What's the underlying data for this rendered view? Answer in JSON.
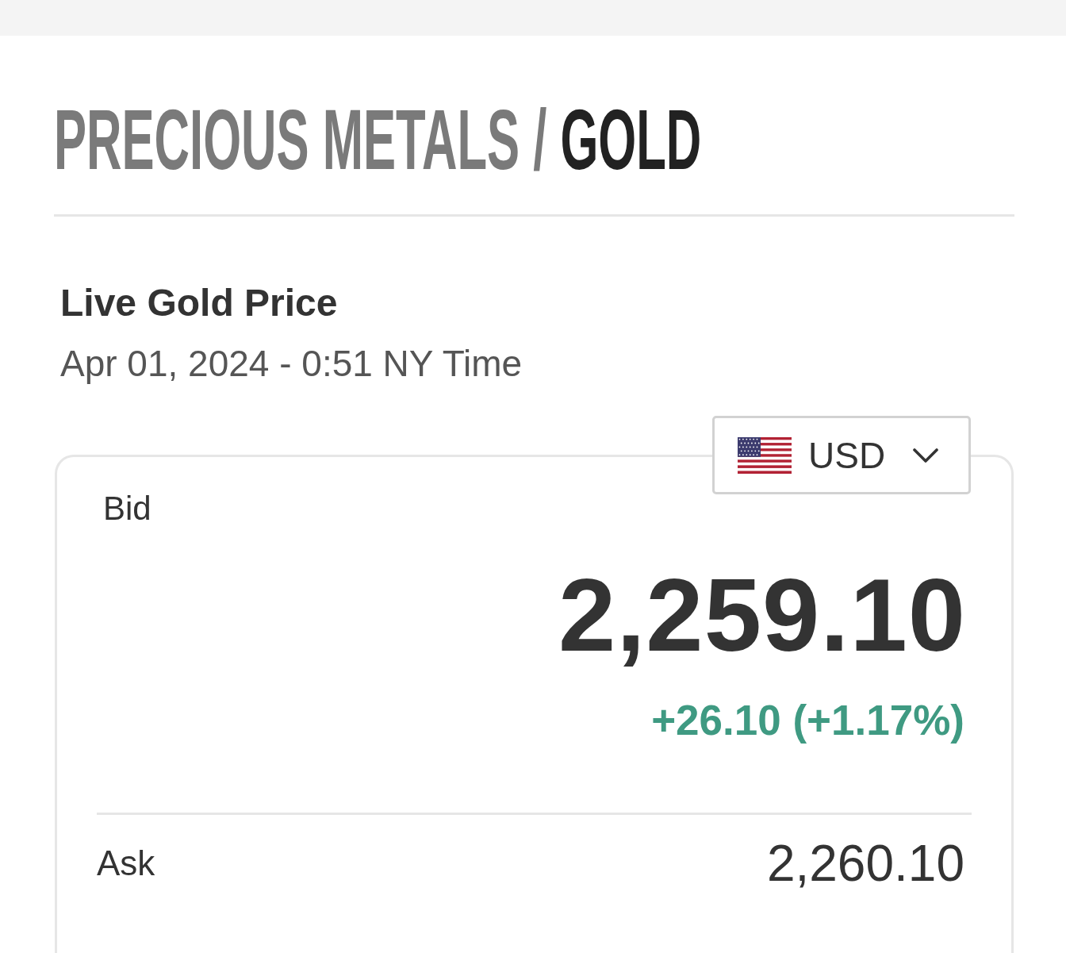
{
  "breadcrumb": {
    "parent": "PRECIOUS METALS",
    "separator": "/",
    "current": "GOLD"
  },
  "price_panel": {
    "title": "Live Gold Price",
    "timestamp": "Apr 01, 2024 - 0:51 NY Time",
    "currency_select": {
      "value": "USD"
    },
    "bid": {
      "label": "Bid",
      "price": "2,259.10",
      "change": "+26.10 (+1.17%)",
      "gain": true
    },
    "ask": {
      "label": "Ask",
      "price": "2,260.10"
    }
  }
}
